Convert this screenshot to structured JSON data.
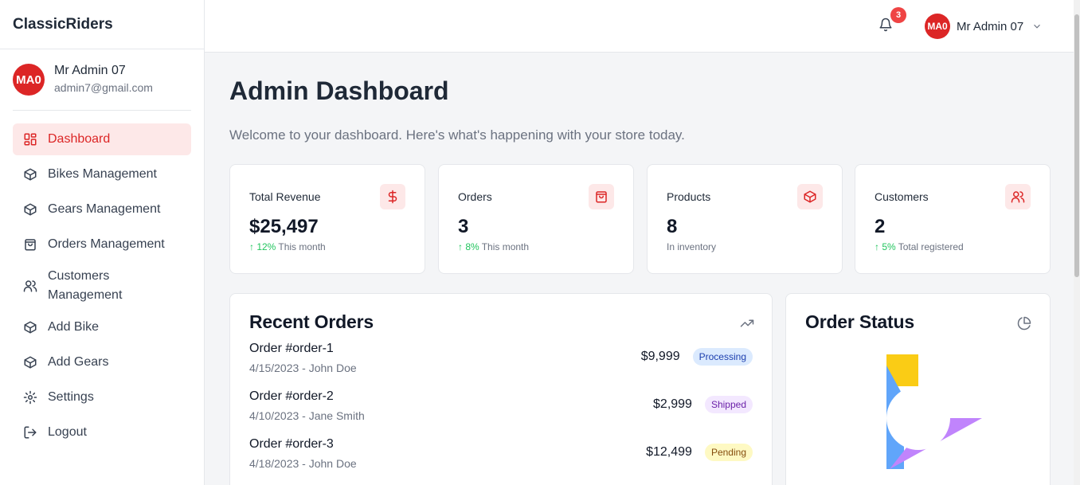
{
  "app": {
    "brand": "ClassicRiders"
  },
  "profile": {
    "initials": "MA0",
    "name": "Mr Admin 07",
    "email": "admin7@gmail.com"
  },
  "sidebar": {
    "items": [
      {
        "label": "Dashboard",
        "icon": "dashboard-icon",
        "active": true
      },
      {
        "label": "Bikes Management",
        "icon": "package-icon"
      },
      {
        "label": "Gears Management",
        "icon": "package-icon"
      },
      {
        "label": "Orders Management",
        "icon": "shopping-bag-icon"
      },
      {
        "label": "Customers Management",
        "icon": "users-icon"
      },
      {
        "label": "Add Bike",
        "icon": "package-icon"
      },
      {
        "label": "Add Gears",
        "icon": "package-icon"
      },
      {
        "label": "Settings",
        "icon": "gear-icon"
      },
      {
        "label": "Logout",
        "icon": "logout-icon"
      }
    ]
  },
  "topbar": {
    "notification_count": "3",
    "user_initials": "MA0",
    "user_name": "Mr Admin 07"
  },
  "main": {
    "title": "Admin Dashboard",
    "subtitle": "Welcome to your dashboard. Here's what's happening with your store today."
  },
  "stats": [
    {
      "title": "Total Revenue",
      "value": "$25,497",
      "trend": "↑ 12%",
      "note": "This month",
      "icon": "dollar-icon"
    },
    {
      "title": "Orders",
      "value": "3",
      "trend": "↑ 8%",
      "note": "This month",
      "icon": "shopping-bag-icon"
    },
    {
      "title": "Products",
      "value": "8",
      "trend": "",
      "note": "In inventory",
      "icon": "package-icon"
    },
    {
      "title": "Customers",
      "value": "2",
      "trend": "↑ 5%",
      "note": "Total registered",
      "icon": "users-icon"
    }
  ],
  "recent_orders": {
    "title": "Recent Orders",
    "icon": "trending-up-icon",
    "rows": [
      {
        "id": "Order #order-1",
        "meta": "4/15/2023 - John Doe",
        "amount": "$9,999",
        "status": "Processing"
      },
      {
        "id": "Order #order-2",
        "meta": "4/10/2023 - Jane Smith",
        "amount": "$2,999",
        "status": "Shipped"
      },
      {
        "id": "Order #order-3",
        "meta": "4/18/2023 - John Doe",
        "amount": "$12,499",
        "status": "Pending"
      }
    ]
  },
  "order_status": {
    "title": "Order Status",
    "icon": "pie-chart-icon",
    "colors": {
      "processing": "#60a5fa",
      "shipped": "#c084fc",
      "pending": "#facc15"
    }
  }
}
